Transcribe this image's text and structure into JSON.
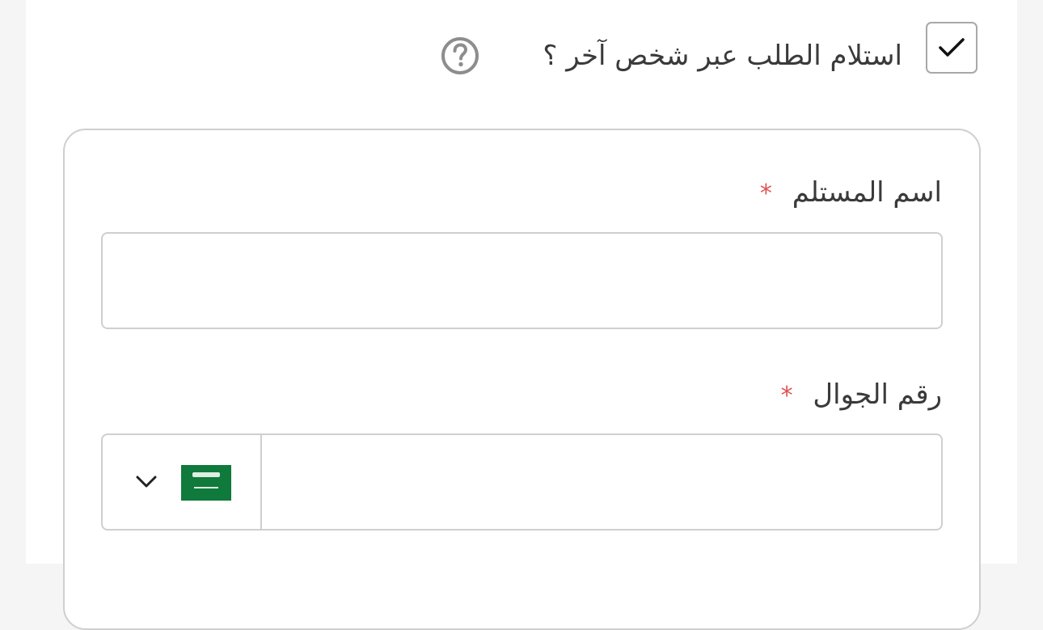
{
  "delivery_option": {
    "title": "استلام الطلب عبر شخص آخر ؟",
    "checked": true,
    "check_icon": "check-icon",
    "help_icon": "question-circle-icon"
  },
  "recipient_form": {
    "name_label": "اسم المستلم",
    "name_required_mark": "*",
    "name_value": "",
    "phone_label": "رقم الجوال",
    "phone_required_mark": "*",
    "phone_value": "",
    "country_flag": "saudi-arabia-flag",
    "dropdown_icon": "chevron-down-icon"
  },
  "colors": {
    "required": "#e05252",
    "border": "#cfcfcf",
    "flag_green": "#0f7a3b"
  }
}
